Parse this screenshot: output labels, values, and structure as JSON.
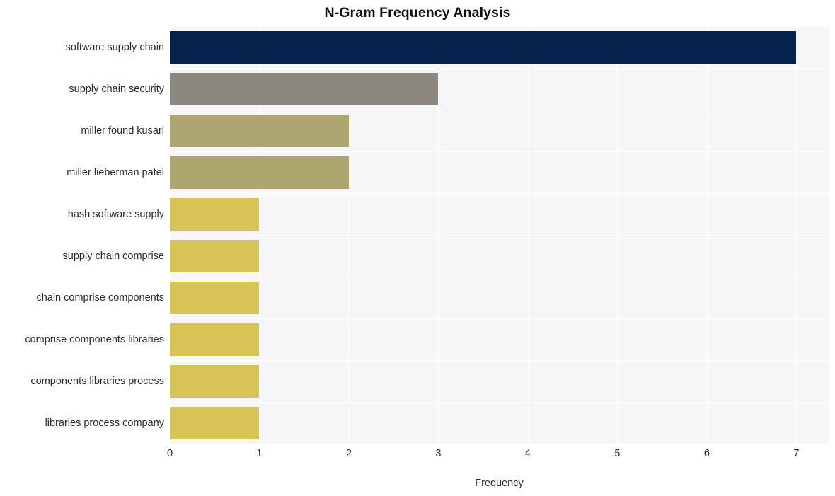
{
  "chart_data": {
    "type": "bar",
    "orientation": "horizontal",
    "title": "N-Gram Frequency Analysis",
    "xlabel": "Frequency",
    "ylabel": "",
    "categories": [
      "software supply chain",
      "supply chain security",
      "miller found kusari",
      "miller lieberman patel",
      "hash software supply",
      "supply chain comprise",
      "chain comprise components",
      "comprise components libraries",
      "components libraries process",
      "libraries process company"
    ],
    "values": [
      7,
      3,
      2,
      2,
      1,
      1,
      1,
      1,
      1,
      1
    ],
    "bar_colors": [
      "#04224c",
      "#8c8880",
      "#aca56f",
      "#ada66f",
      "#d7c356",
      "#d7c356",
      "#d7c356",
      "#d7c356",
      "#d7c356",
      "#d7c356"
    ],
    "xlim": [
      0,
      7.36
    ],
    "xticks": [
      0,
      1,
      2,
      3,
      4,
      5,
      6,
      7
    ],
    "xtick_labels": [
      "0",
      "1",
      "2",
      "3",
      "4",
      "5",
      "6",
      "7"
    ],
    "grid": true,
    "grid_color": "#ffffff",
    "plot_background": "#f6f6f8",
    "figure_background": "#ffffff",
    "legend": null,
    "legend_position": "none"
  }
}
